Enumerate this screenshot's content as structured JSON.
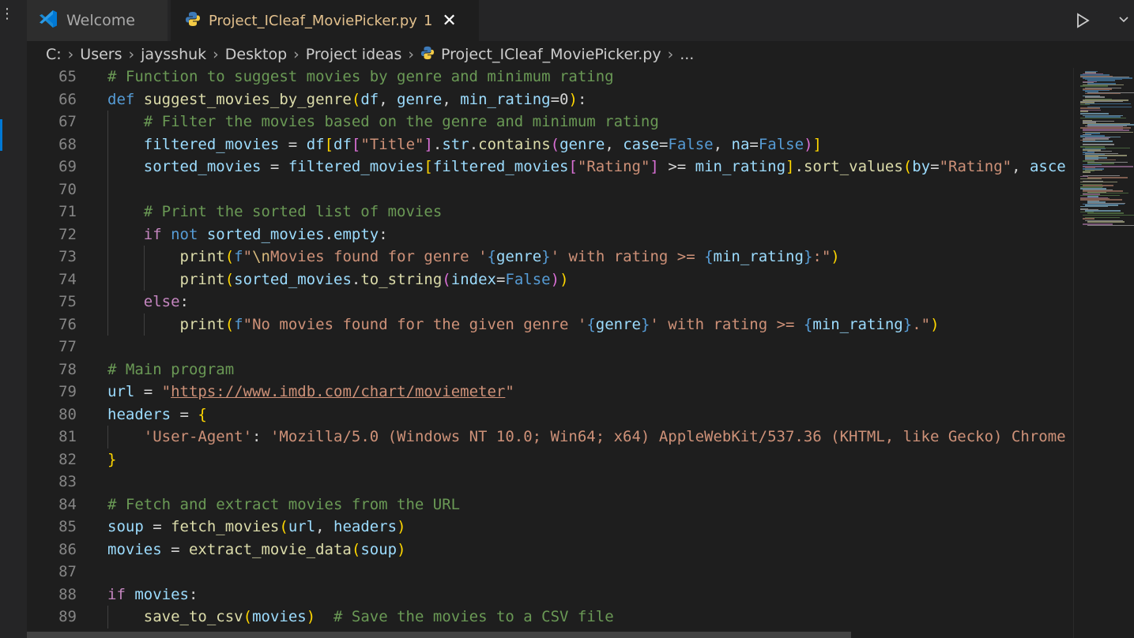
{
  "tabs": [
    {
      "label": "Welcome",
      "icon": "vscode-logo-icon",
      "active": false
    },
    {
      "label": "Project_ICleaf_MoviePicker.py",
      "icon": "python-icon",
      "badge": "1",
      "active": true
    }
  ],
  "breadcrumb": [
    "C:",
    "Users",
    "jaysshuk",
    "Desktop",
    "Project ideas",
    "Project_ICleaf_MoviePicker.py",
    "..."
  ],
  "editor": {
    "lines": [
      {
        "n": "65",
        "tokens": [
          [
            "cm",
            "# Function to suggest movies by genre and minimum rating"
          ]
        ]
      },
      {
        "n": "66",
        "tokens": [
          [
            "kw",
            "def "
          ],
          [
            "fn",
            "suggest_movies_by_genre"
          ],
          [
            "b1",
            "("
          ],
          [
            "var",
            "df"
          ],
          [
            "p",
            ", "
          ],
          [
            "var",
            "genre"
          ],
          [
            "p",
            ", "
          ],
          [
            "var",
            "min_rating"
          ],
          [
            "p",
            "="
          ],
          [
            "p",
            "0"
          ],
          [
            "b1",
            ")"
          ],
          [
            "p",
            ":"
          ]
        ]
      },
      {
        "n": "67",
        "guides": [
          1
        ],
        "tokens": [
          [
            "p",
            "    "
          ],
          [
            "cm",
            "# Filter the movies based on the genre and minimum rating"
          ]
        ]
      },
      {
        "n": "68",
        "guides": [
          1
        ],
        "tokens": [
          [
            "p",
            "    "
          ],
          [
            "var",
            "filtered_movies"
          ],
          [
            "p",
            " = "
          ],
          [
            "var",
            "df"
          ],
          [
            "b1",
            "["
          ],
          [
            "var",
            "df"
          ],
          [
            "b2",
            "["
          ],
          [
            "str",
            "\"Title\""
          ],
          [
            "b2",
            "]"
          ],
          [
            "p",
            "."
          ],
          [
            "var",
            "str"
          ],
          [
            "p",
            "."
          ],
          [
            "fn",
            "contains"
          ],
          [
            "b2",
            "("
          ],
          [
            "var",
            "genre"
          ],
          [
            "p",
            ", "
          ],
          [
            "var",
            "case"
          ],
          [
            "p",
            "="
          ],
          [
            "kw",
            "False"
          ],
          [
            "p",
            ", "
          ],
          [
            "var",
            "na"
          ],
          [
            "p",
            "="
          ],
          [
            "kw",
            "False"
          ],
          [
            "b2",
            ")"
          ],
          [
            "b1",
            "]"
          ]
        ]
      },
      {
        "n": "69",
        "guides": [
          1
        ],
        "tokens": [
          [
            "p",
            "    "
          ],
          [
            "var",
            "sorted_movies"
          ],
          [
            "p",
            " = "
          ],
          [
            "var",
            "filtered_movies"
          ],
          [
            "b1",
            "["
          ],
          [
            "var",
            "filtered_movies"
          ],
          [
            "b2",
            "["
          ],
          [
            "str",
            "\"Rating\""
          ],
          [
            "b2",
            "]"
          ],
          [
            "p",
            " >= "
          ],
          [
            "var",
            "min_rating"
          ],
          [
            "b1",
            "]"
          ],
          [
            "p",
            "."
          ],
          [
            "fn",
            "sort_values"
          ],
          [
            "b1",
            "("
          ],
          [
            "var",
            "by"
          ],
          [
            "p",
            "="
          ],
          [
            "str",
            "\"Rating\""
          ],
          [
            "p",
            ", "
          ],
          [
            "var",
            "asce"
          ]
        ]
      },
      {
        "n": "70",
        "guides": [
          1
        ],
        "tokens": []
      },
      {
        "n": "71",
        "guides": [
          1
        ],
        "tokens": [
          [
            "p",
            "    "
          ],
          [
            "cm",
            "# Print the sorted list of movies"
          ]
        ]
      },
      {
        "n": "72",
        "guides": [
          1
        ],
        "tokens": [
          [
            "p",
            "    "
          ],
          [
            "ctl",
            "if "
          ],
          [
            "kw",
            "not "
          ],
          [
            "var",
            "sorted_movies"
          ],
          [
            "p",
            "."
          ],
          [
            "var",
            "empty"
          ],
          [
            "p",
            ":"
          ]
        ]
      },
      {
        "n": "73",
        "guides": [
          1,
          2
        ],
        "tokens": [
          [
            "p",
            "        "
          ],
          [
            "fn",
            "print"
          ],
          [
            "b1",
            "("
          ],
          [
            "kw",
            "f"
          ],
          [
            "str",
            "\""
          ],
          [
            "esc",
            "\\n"
          ],
          [
            "str",
            "Movies found for genre '"
          ],
          [
            "kw",
            "{"
          ],
          [
            "var",
            "genre"
          ],
          [
            "kw",
            "}"
          ],
          [
            "str",
            "' with rating >= "
          ],
          [
            "kw",
            "{"
          ],
          [
            "var",
            "min_rating"
          ],
          [
            "kw",
            "}"
          ],
          [
            "str",
            ":\""
          ],
          [
            "b1",
            ")"
          ]
        ]
      },
      {
        "n": "74",
        "guides": [
          1,
          2
        ],
        "tokens": [
          [
            "p",
            "        "
          ],
          [
            "fn",
            "print"
          ],
          [
            "b1",
            "("
          ],
          [
            "var",
            "sorted_movies"
          ],
          [
            "p",
            "."
          ],
          [
            "fn",
            "to_string"
          ],
          [
            "b2",
            "("
          ],
          [
            "var",
            "index"
          ],
          [
            "p",
            "="
          ],
          [
            "kw",
            "False"
          ],
          [
            "b2",
            ")"
          ],
          [
            "b1",
            ")"
          ]
        ]
      },
      {
        "n": "75",
        "guides": [
          1
        ],
        "tokens": [
          [
            "p",
            "    "
          ],
          [
            "ctl",
            "else"
          ],
          [
            "p",
            ":"
          ]
        ]
      },
      {
        "n": "76",
        "guides": [
          1,
          2
        ],
        "tokens": [
          [
            "p",
            "        "
          ],
          [
            "fn",
            "print"
          ],
          [
            "b1",
            "("
          ],
          [
            "kw",
            "f"
          ],
          [
            "str",
            "\"No movies found for the given genre '"
          ],
          [
            "kw",
            "{"
          ],
          [
            "var",
            "genre"
          ],
          [
            "kw",
            "}"
          ],
          [
            "str",
            "' with rating >= "
          ],
          [
            "kw",
            "{"
          ],
          [
            "var",
            "min_rating"
          ],
          [
            "kw",
            "}"
          ],
          [
            "str",
            ".\""
          ],
          [
            "b1",
            ")"
          ]
        ]
      },
      {
        "n": "77",
        "tokens": []
      },
      {
        "n": "78",
        "tokens": [
          [
            "cm",
            "# Main program"
          ]
        ]
      },
      {
        "n": "79",
        "tokens": [
          [
            "var",
            "url"
          ],
          [
            "p",
            " = "
          ],
          [
            "str",
            "\""
          ],
          [
            "link",
            "https://www.imdb.com/chart/moviemeter"
          ],
          [
            "str",
            "\""
          ]
        ]
      },
      {
        "n": "80",
        "tokens": [
          [
            "var",
            "headers"
          ],
          [
            "p",
            " = "
          ],
          [
            "b1",
            "{"
          ]
        ]
      },
      {
        "n": "81",
        "guides": [
          1
        ],
        "tokens": [
          [
            "p",
            "    "
          ],
          [
            "str",
            "'User-Agent'"
          ],
          [
            "p",
            ": "
          ],
          [
            "str",
            "'Mozilla/5.0 (Windows NT 10.0; Win64; x64) AppleWebKit/537.36 (KHTML, like Gecko) Chrome"
          ]
        ]
      },
      {
        "n": "82",
        "tokens": [
          [
            "b1",
            "}"
          ]
        ]
      },
      {
        "n": "83",
        "tokens": []
      },
      {
        "n": "84",
        "tokens": [
          [
            "cm",
            "# Fetch and extract movies from the URL"
          ]
        ]
      },
      {
        "n": "85",
        "tokens": [
          [
            "var",
            "soup"
          ],
          [
            "p",
            " = "
          ],
          [
            "fn",
            "fetch_movies"
          ],
          [
            "b1",
            "("
          ],
          [
            "var",
            "url"
          ],
          [
            "p",
            ", "
          ],
          [
            "var",
            "headers"
          ],
          [
            "b1",
            ")"
          ]
        ]
      },
      {
        "n": "86",
        "tokens": [
          [
            "var",
            "movies"
          ],
          [
            "p",
            " = "
          ],
          [
            "fn",
            "extract_movie_data"
          ],
          [
            "b1",
            "("
          ],
          [
            "var",
            "soup"
          ],
          [
            "b1",
            ")"
          ]
        ]
      },
      {
        "n": "87",
        "tokens": []
      },
      {
        "n": "88",
        "tokens": [
          [
            "ctl",
            "if "
          ],
          [
            "var",
            "movies"
          ],
          [
            "p",
            ":"
          ]
        ]
      },
      {
        "n": "89",
        "guides": [
          1
        ],
        "tokens": [
          [
            "p",
            "    "
          ],
          [
            "fn",
            "save_to_csv"
          ],
          [
            "b1",
            "("
          ],
          [
            "var",
            "movies"
          ],
          [
            "b1",
            ")"
          ],
          [
            "p",
            "  "
          ],
          [
            "cm",
            "# Save the movies to a CSV file"
          ]
        ]
      }
    ]
  }
}
